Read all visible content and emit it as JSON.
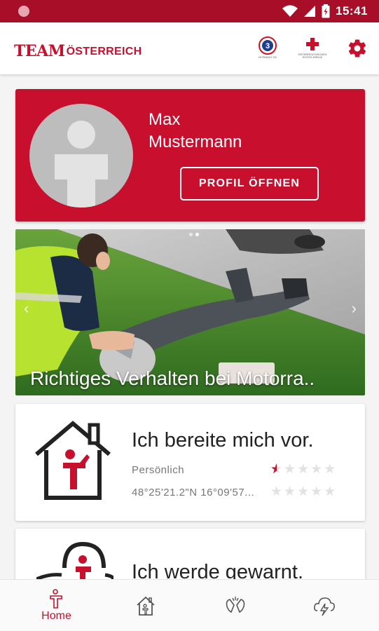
{
  "status_bar": {
    "time": "15:41"
  },
  "app_bar": {
    "logo_team": "TEAM",
    "logo_country": "ÖSTERREICH",
    "partner1_caption": "HITRADIO Ö3",
    "partner2_caption": "ÖSTERREICHISCHES ROTES KREUZ"
  },
  "profile": {
    "first_name": "Max",
    "last_name": "Mustermann",
    "button_label": "PROFIL ÖFFNEN"
  },
  "banner": {
    "caption": "Richtiges Verhalten bei Motorra..",
    "slide_count": 2,
    "active_slide": 2
  },
  "cards": [
    {
      "title": "Ich bereite mich vor.",
      "subtitle": "Persönlich",
      "rating": 0.5,
      "location": "48°25'21.2\"N 16°09'57...",
      "location_rating": 0
    },
    {
      "title": "Ich werde gewarnt."
    }
  ],
  "bottom_nav": {
    "home_label": "Home",
    "items": [
      "home-icon",
      "house-icon",
      "hands-icon",
      "thunderstorm-icon"
    ]
  },
  "colors": {
    "brand_red": "#c8102e",
    "status_bar": "#a80e27"
  }
}
